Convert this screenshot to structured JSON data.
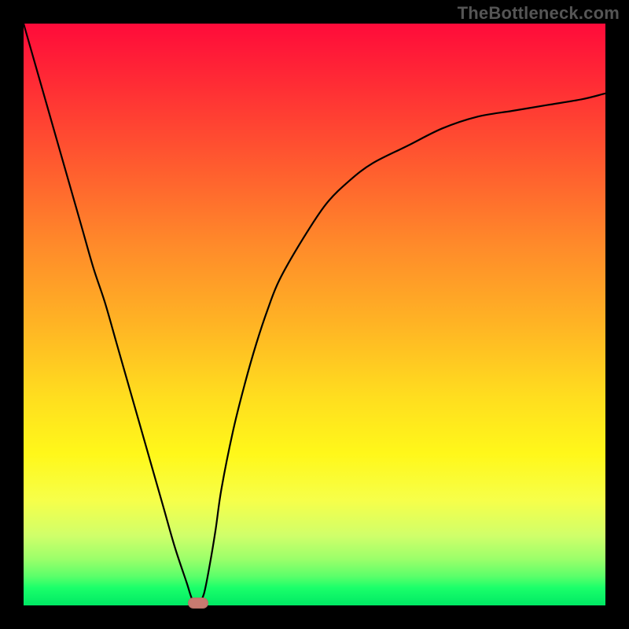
{
  "watermark": "TheBottleneck.com",
  "chart_data": {
    "type": "line",
    "title": "",
    "xlabel": "",
    "ylabel": "",
    "xlim": [
      0,
      100
    ],
    "ylim": [
      0,
      100
    ],
    "grid": false,
    "legend": false,
    "series": [
      {
        "name": "bottleneck-curve",
        "x": [
          0,
          2,
          4,
          6,
          8,
          10,
          12,
          14,
          16,
          18,
          20,
          22,
          24,
          26,
          28,
          29,
          30,
          31,
          32,
          33,
          34,
          36,
          38,
          40,
          42,
          44,
          48,
          52,
          56,
          60,
          66,
          72,
          78,
          84,
          90,
          96,
          100
        ],
        "values": [
          100,
          93,
          86,
          79,
          72,
          65,
          58,
          52,
          45,
          38,
          31,
          24,
          17,
          10,
          4,
          1,
          0,
          2,
          7,
          13,
          20,
          30,
          38,
          45,
          51,
          56,
          63,
          69,
          73,
          76,
          79,
          82,
          84,
          85,
          86,
          87,
          88
        ]
      }
    ],
    "annotations": [
      {
        "name": "optimum-marker",
        "x": 30,
        "y": 0
      }
    ],
    "background_gradient": {
      "stops": [
        {
          "pos": 0,
          "color": "#ff0b3a"
        },
        {
          "pos": 50,
          "color": "#ffb524"
        },
        {
          "pos": 75,
          "color": "#fff81a"
        },
        {
          "pos": 100,
          "color": "#00e864"
        }
      ]
    }
  }
}
